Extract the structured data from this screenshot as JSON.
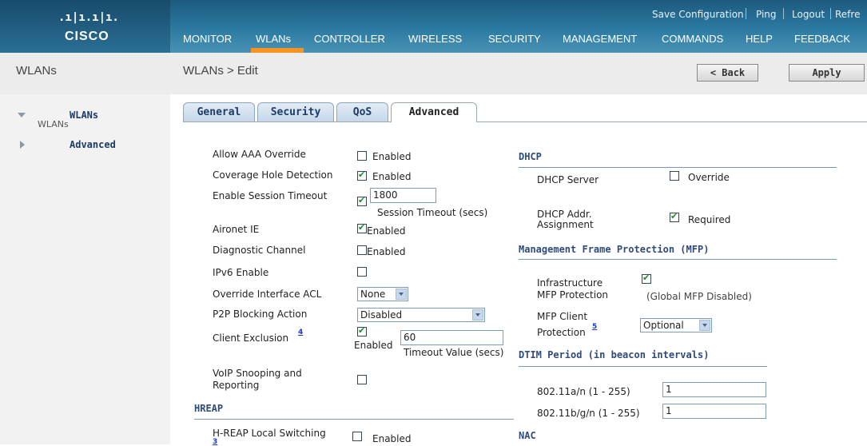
{
  "header": {
    "logo_text": "CISCO",
    "top_links": [
      "Save Configuration",
      "Ping",
      "Logout",
      "Refre"
    ],
    "nav": [
      "MONITOR",
      "WLANs",
      "CONTROLLER",
      "WIRELESS",
      "SECURITY",
      "MANAGEMENT",
      "COMMANDS",
      "HELP",
      "FEEDBACK"
    ],
    "active_nav": "WLANs",
    "accent_color": "#f7931e"
  },
  "left": {
    "title": "WLANs",
    "items": [
      {
        "label": "WLANs",
        "sub": "WLANs",
        "icon": "triangle-down-icon"
      },
      {
        "label": "Advanced",
        "icon": "triangle-right-icon"
      }
    ]
  },
  "page": {
    "title": "WLANs > Edit",
    "back_label": "< Back",
    "apply_label": "Apply"
  },
  "tabs": [
    "General",
    "Security",
    "QoS",
    "Advanced"
  ],
  "active_tab": "Advanced",
  "left_col": {
    "allow_aaa": {
      "label": "Allow AAA Override",
      "checkbox": "Enabled",
      "checked": false
    },
    "coverage_hole": {
      "label": "Coverage Hole Detection",
      "checkbox": "Enabled",
      "checked": true
    },
    "session_timeout": {
      "label": "Enable Session Timeout",
      "checked": true,
      "value": "1800",
      "sublabel": "Session Timeout (secs)"
    },
    "aironet_ie": {
      "label": "Aironet IE",
      "checkbox": "Enabled",
      "checked": true
    },
    "diagnostic": {
      "label": "Diagnostic Channel",
      "checkbox": "Enabled",
      "checked": false
    },
    "ipv6": {
      "label": "IPv6 Enable",
      "checked": false
    },
    "override_acl": {
      "label": "Override Interface ACL",
      "value": "None"
    },
    "p2p": {
      "label": "P2P Blocking Action",
      "value": "Disabled"
    },
    "client_exclusion": {
      "label": "Client Exclusion",
      "footnote": "4",
      "checkbox": "Enabled",
      "checked": true,
      "value": "60",
      "sublabel": "Timeout Value (secs)"
    },
    "voip": {
      "label1": "VoIP Snooping and",
      "label2": "Reporting",
      "checked": false
    },
    "hreap_section": "HREAP",
    "hreap_local": {
      "label": "H-REAP Local Switching",
      "footnote": "3",
      "checkbox": "Enabled",
      "checked": false
    }
  },
  "right_col": {
    "dhcp_section": "DHCP",
    "dhcp_server": {
      "label": "DHCP Server",
      "checkbox": "Override",
      "checked": false
    },
    "dhcp_addr": {
      "label1": "DHCP Addr.",
      "label2": "Assignment",
      "checkbox": "Required",
      "checked": true
    },
    "mfp_section": "Management Frame Protection (MFP)",
    "infra_mfp": {
      "label1": "Infrastructure",
      "label2": "MFP Protection",
      "checked": true,
      "note": "(Global MFP Disabled)"
    },
    "mfp_client": {
      "label1": "MFP Client",
      "label2": "Protection",
      "footnote": "5",
      "value": "Optional"
    },
    "dtim_section": "DTIM Period (in beacon intervals)",
    "dtim_a": {
      "label": "802.11a/n (1 - 255)",
      "value": "1"
    },
    "dtim_b": {
      "label": "802.11b/g/n (1 - 255)",
      "value": "1"
    },
    "nac_section": "NAC"
  }
}
